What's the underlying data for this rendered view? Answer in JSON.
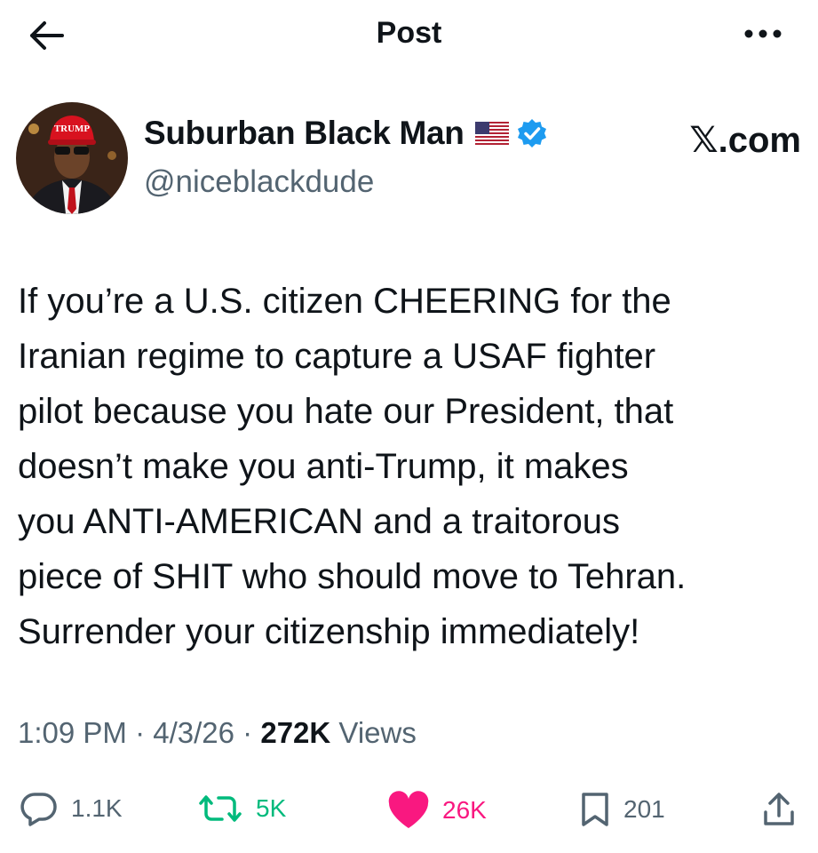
{
  "header": {
    "title": "Post"
  },
  "author": {
    "name": "Suburban Black Man",
    "handle": "@niceblackdude",
    "hat_text": "TRUMP",
    "source": "𝕏.com"
  },
  "tweet": {
    "text": "If you’re a U.S. citizen CHEERING for the\nIranian regime to capture a USAF fighter\npilot because you hate our President, that\ndoesn’t make you anti-Trump, it makes\nyou ANTI-AMERICAN and a traitorous\npiece of SHIT who should move to Tehran.\nSurrender your citizenship immediately!"
  },
  "meta": {
    "time": "1:09 PM",
    "date": "4/3/26",
    "views_count": "272K",
    "views_label": "Views",
    "separator": "·"
  },
  "actions": {
    "replies": "1.1K",
    "reposts": "5K",
    "likes": "26K",
    "bookmarks": "201"
  },
  "icons": [
    "back-arrow-icon",
    "more-icon",
    "us-flag-icon",
    "verified-badge-icon",
    "reply-icon",
    "repost-icon",
    "like-icon",
    "bookmark-icon",
    "share-icon"
  ],
  "colors": {
    "verified": "#1d9bf0",
    "repost": "#00ba7c",
    "like": "#f91880",
    "secondary": "#536471"
  }
}
